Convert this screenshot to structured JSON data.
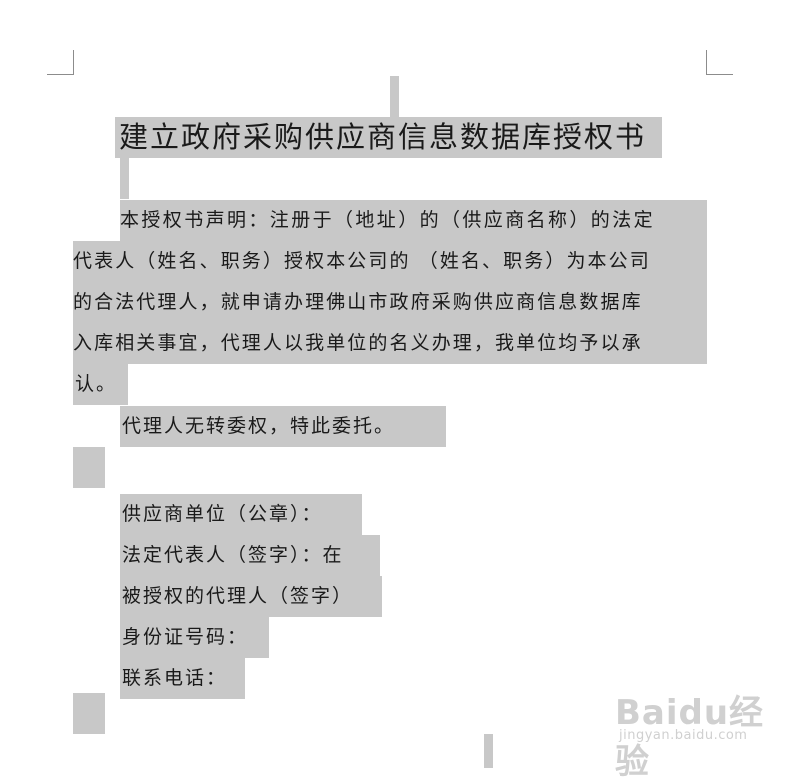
{
  "document": {
    "title": "建立政府采购供应商信息数据库授权书",
    "statement_lines": [
      "本授权书声明：注册于（地址）的（供应商名称）的法定",
      "代表人（姓名、职务）授权本公司的 （姓名、职务）为本公司",
      "的合法代理人，就申请办理佛山市政府采购供应商信息数据库",
      "入库相关事宜，代理人以我单位的名义办理，我单位均予以承",
      "认。"
    ],
    "entrust": "代理人无转委权，特此委托。",
    "signatures": [
      "供应商单位（公章）：",
      "法定代表人（签字）：在",
      "被授权的代理人（签字）",
      "身份证号码：",
      "联系电话："
    ]
  },
  "watermark": {
    "logo_text": "Baidu经验",
    "url": "jingyan.baidu.com",
    "paw_icon": "paw-icon"
  },
  "colors": {
    "selection": "#c8c8c8",
    "text": "#1a1a1a",
    "page_corner": "#8c8c8c"
  }
}
